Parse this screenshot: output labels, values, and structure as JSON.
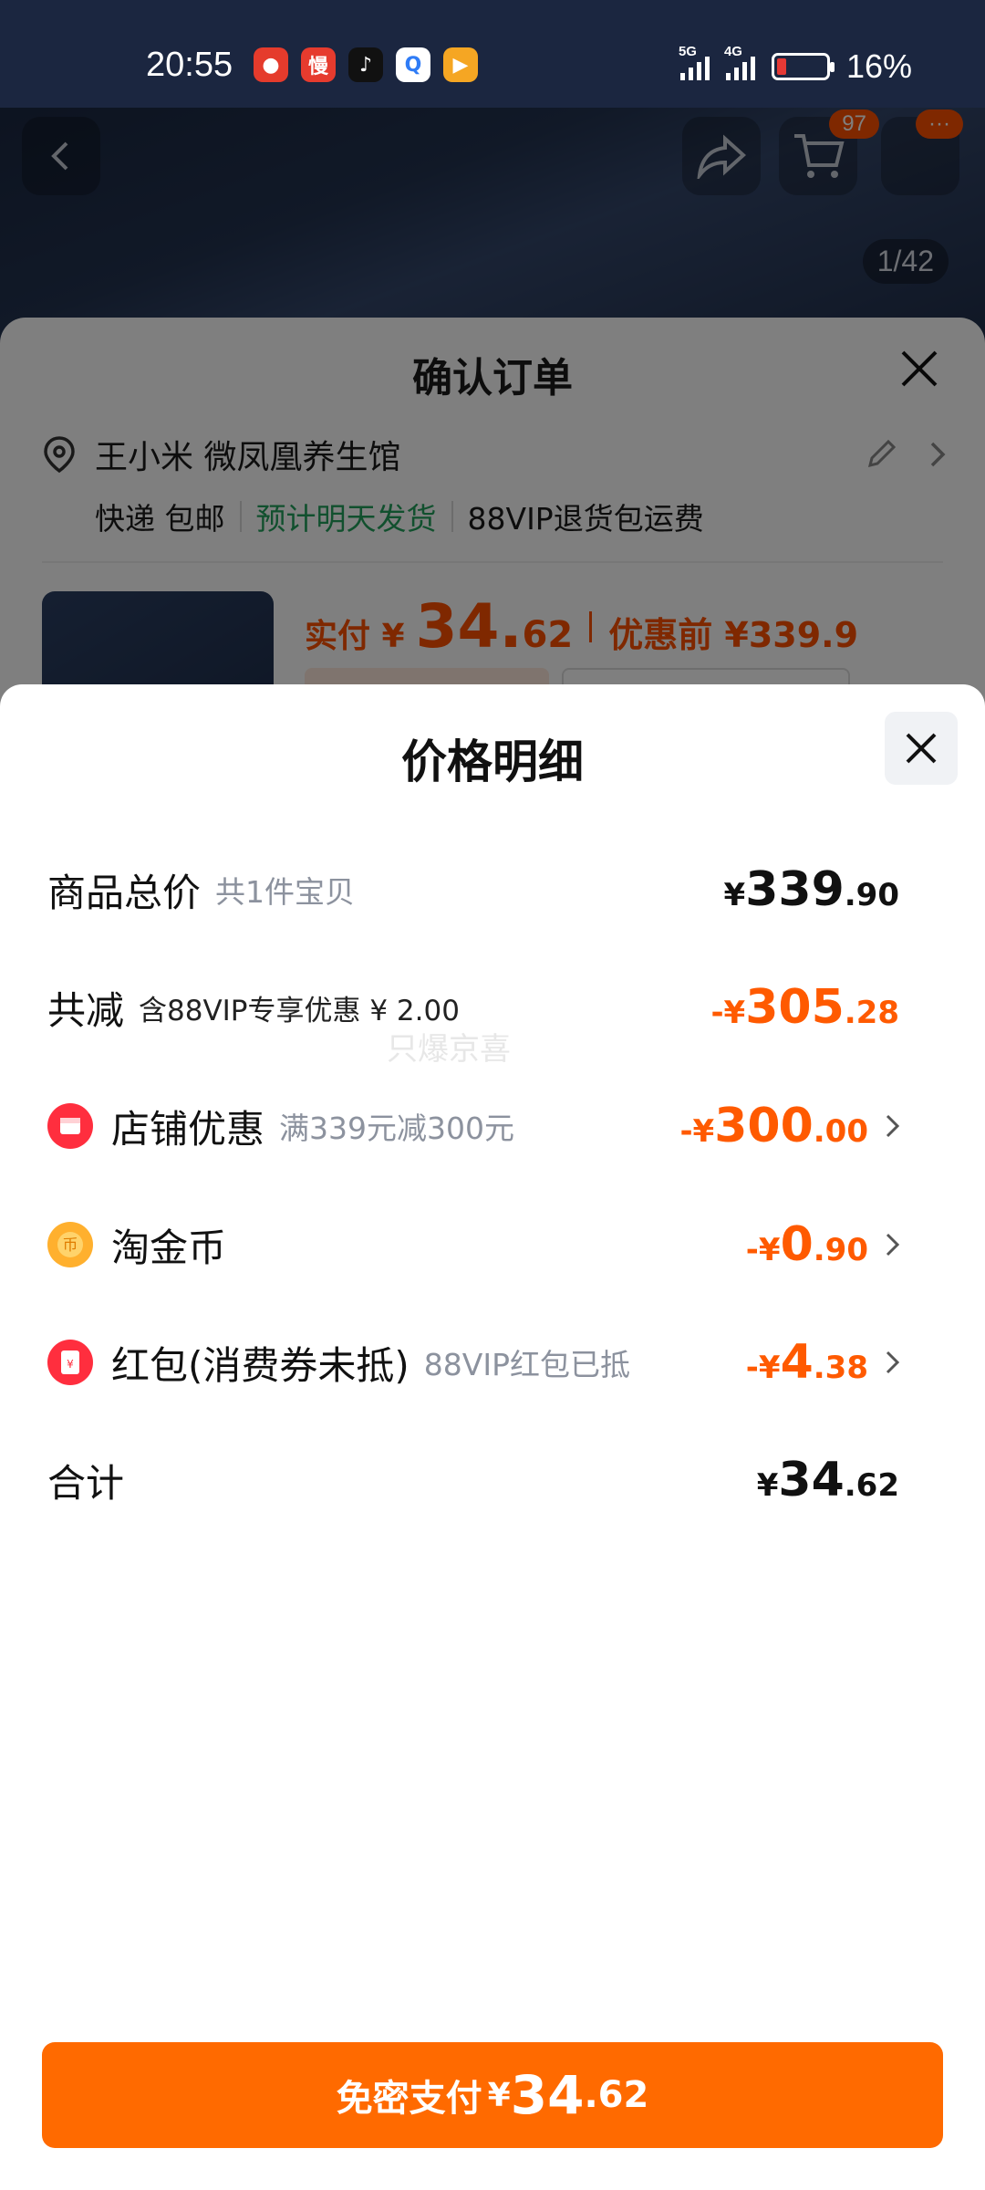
{
  "status_bar": {
    "time": "20:55",
    "apps": [
      {
        "name": "app-red-icon",
        "glyph": "●",
        "color": "#e53b2c"
      },
      {
        "name": "app-man-icon",
        "glyph": "慢",
        "color": "#e63b2e"
      },
      {
        "name": "tiktok-icon",
        "glyph": "♪",
        "color": "#111111"
      },
      {
        "name": "search-app-icon",
        "glyph": "Q",
        "color": "#2f7cf6"
      },
      {
        "name": "video-app-icon",
        "glyph": "▶",
        "color": "#f5a623"
      }
    ],
    "signal_1": "5G",
    "signal_2": "4G",
    "battery": "16%"
  },
  "product_page": {
    "cart_badge": "97",
    "more_badge": "···",
    "image_counter": "1/42"
  },
  "order_sheet": {
    "title": "确认订单",
    "address": "王小米 微凤凰养生馆",
    "ship_1": "快递 包邮",
    "ship_2": "预计明天发货",
    "ship_3": "88VIP退货包运费",
    "pay_label": "实付 ¥",
    "pay_int": "34.",
    "pay_frac": "62",
    "before_label": "优惠前 ¥339.9"
  },
  "price_detail": {
    "title": "价格明细",
    "rows": {
      "total": {
        "label": "商品总价",
        "sub": "共1件宝贝",
        "cur": "¥",
        "int": "339",
        "frac": ".90"
      },
      "reduce": {
        "label": "共减",
        "sub": "含88VIP专享优惠 ¥ 2.00",
        "cur": "-¥",
        "int": "305",
        "frac": ".28"
      },
      "store": {
        "label": "店铺优惠",
        "sub": "满339元减300元",
        "cur": "-¥",
        "int": "300",
        "frac": ".00"
      },
      "coin": {
        "label": "淘金币",
        "sub": "",
        "cur": "-¥",
        "int": "0",
        "frac": ".90"
      },
      "redpack": {
        "label": "红包(消费券未抵)",
        "sub": "88VIP红包已抵",
        "cur": "-¥",
        "int": "4",
        "frac": ".38"
      },
      "sum": {
        "label": "合计",
        "cur": "¥",
        "int": "34",
        "frac": ".62"
      }
    },
    "watermark": "只爆京喜"
  },
  "pay_button": {
    "label": "免密支付",
    "cur": "¥",
    "int": "34",
    "frac": ".62"
  },
  "colors": {
    "accent": "#ff6a00",
    "discount": "#ff5a00",
    "green": "#22a05c"
  }
}
